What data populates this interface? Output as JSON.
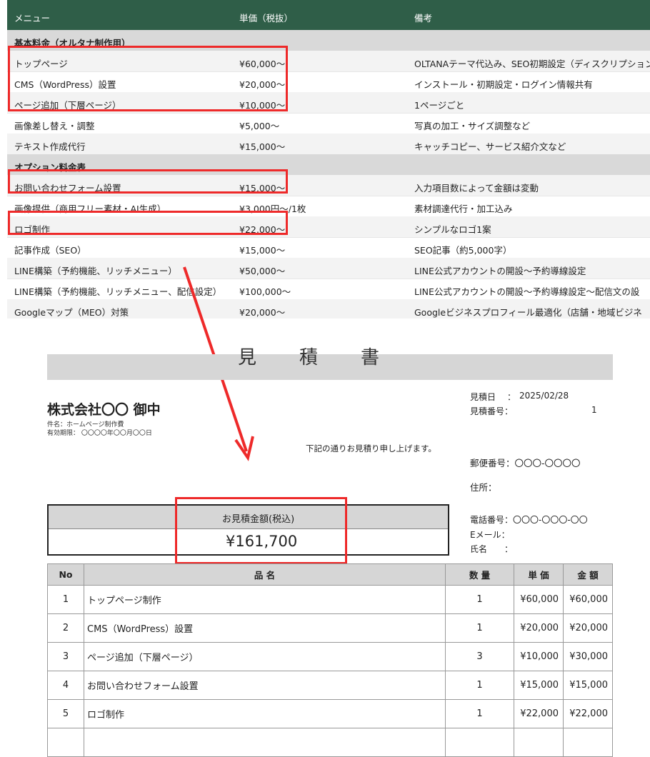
{
  "price_table": {
    "headers": [
      "メニュー",
      "単価（税抜）",
      "備考"
    ],
    "rows": [
      {
        "type": "section",
        "menu": "基本料金（オルタナ制作用）"
      },
      {
        "menu": "トップページ",
        "price": "¥60,000〜",
        "note": "OLTANAテーマ代込み、SEO初期設定（ディスクリプション"
      },
      {
        "menu": "CMS（WordPress）設置",
        "price": "¥20,000〜",
        "note": "インストール・初期設定・ログイン情報共有"
      },
      {
        "menu": "ページ追加（下層ページ）",
        "price": "¥10,000〜",
        "note": "1ページごと"
      },
      {
        "menu": "画像差し替え・調整",
        "price": "¥5,000〜",
        "note": "写真の加工・サイズ調整など"
      },
      {
        "menu": "テキスト作成代行",
        "price": "¥15,000〜",
        "note": "キャッチコピー、サービス紹介文など"
      },
      {
        "type": "section",
        "menu": "オプション料金表"
      },
      {
        "menu": "お問い合わせフォーム設置",
        "price": "¥15,000〜",
        "note": "入力項目数によって金額は変動"
      },
      {
        "menu": "画像提供（商用フリー素材・AI生成）",
        "price": "¥3,000円〜/1枚",
        "note": "素材調達代行・加工込み"
      },
      {
        "menu": "ロゴ制作",
        "price": "¥22,000〜",
        "note": "シンプルなロゴ1案"
      },
      {
        "menu": "記事作成（SEO）",
        "price": "¥15,000〜",
        "note": "SEO記事（約5,000字）"
      },
      {
        "menu": "LINE構築（予約機能、リッチメニュー）",
        "price": "¥50,000〜",
        "note": "LINE公式アカウントの開設〜予約導線設定"
      },
      {
        "menu": "LINE構築（予約機能、リッチメニュー、配信設定）",
        "price": "¥100,000〜",
        "note": "LINE公式アカウントの開設〜予約導線設定〜配信文の設"
      },
      {
        "menu": "Googleマップ（MEO）対策",
        "price": "¥20,000〜",
        "note": "Googleビジネスプロフィール最適化（店舗・地域ビジネ"
      }
    ]
  },
  "estimate": {
    "title": "見積書",
    "recipient": "株式会社〇〇 御中",
    "subject": "件名：ホームページ制作費",
    "validity": "有効期限： 〇〇〇〇年〇〇月〇〇日",
    "intro": "下記の通りお見積り申し上げます。",
    "date_label": "見積日",
    "date_sep": "：",
    "date": "2025/02/28",
    "number_label": "見積番号：",
    "number": "1",
    "postal": "郵便番号：〇〇〇-〇〇〇〇",
    "address": "住所：",
    "phone": "電話番号：〇〇〇-〇〇〇-〇〇",
    "email": "Eメール：",
    "name": "氏名　　：",
    "total_label": "お見積金額(税込)",
    "total": "¥161,700",
    "columns": {
      "no": "No",
      "item": "品 名",
      "qty": "数 量",
      "unit": "単 価",
      "amount": "金 額"
    },
    "items": [
      {
        "no": "1",
        "name": "トップページ制作",
        "qty": "1",
        "unit": "¥60,000",
        "amount": "¥60,000"
      },
      {
        "no": "2",
        "name": "CMS（WordPress）設置",
        "qty": "1",
        "unit": "¥20,000",
        "amount": "¥20,000"
      },
      {
        "no": "3",
        "name": "ページ追加（下層ページ）",
        "qty": "3",
        "unit": "¥10,000",
        "amount": "¥30,000"
      },
      {
        "no": "4",
        "name": "お問い合わせフォーム設置",
        "qty": "1",
        "unit": "¥15,000",
        "amount": "¥15,000"
      },
      {
        "no": "5",
        "name": "ロゴ制作",
        "qty": "1",
        "unit": "¥22,000",
        "amount": "¥22,000"
      },
      {
        "no": "",
        "name": "",
        "qty": "",
        "unit": "",
        "amount": ""
      }
    ]
  },
  "annotation_color": "#ee2a2a",
  "header_color": "#2f5e48"
}
